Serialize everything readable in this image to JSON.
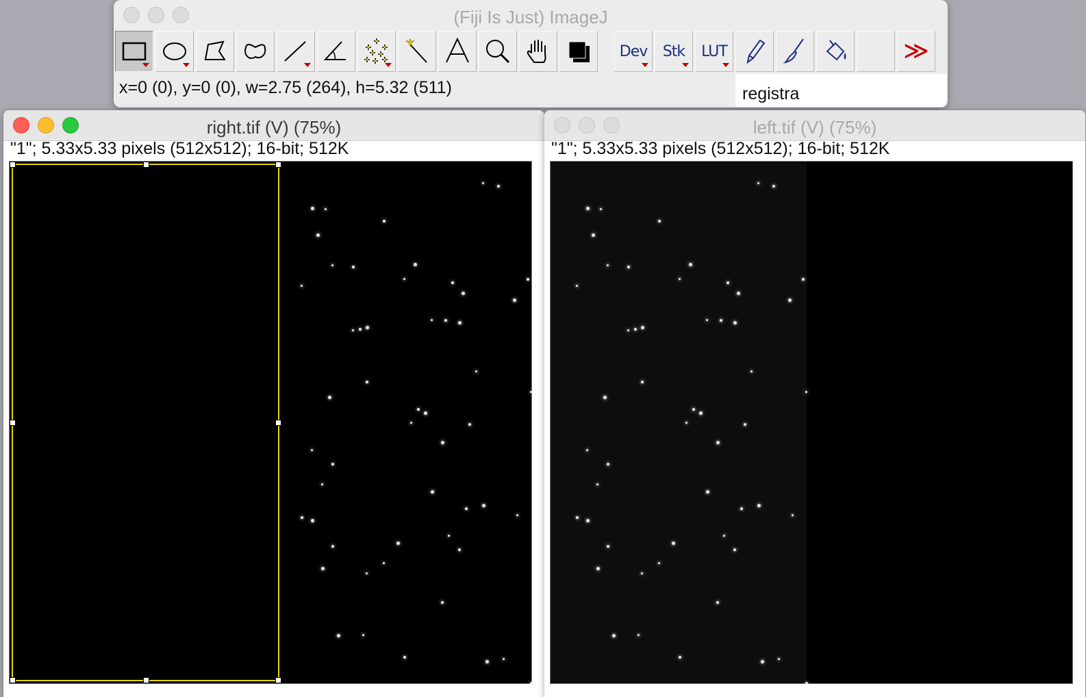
{
  "imagej": {
    "title": "(Fiji Is Just) ImageJ",
    "status": "x=0 (0), y=0 (0), w=2.75 (264), h=5.32 (511)",
    "search_value": "registra",
    "tools": [
      {
        "name": "rectangle-tool",
        "icon": "rectangle-icon",
        "selected": true
      },
      {
        "name": "oval-tool",
        "icon": "oval-icon"
      },
      {
        "name": "polygon-tool",
        "icon": "polygon-icon"
      },
      {
        "name": "freehand-tool",
        "icon": "freehand-icon"
      },
      {
        "name": "line-tool",
        "icon": "line-icon"
      },
      {
        "name": "angle-tool",
        "icon": "angle-icon"
      },
      {
        "name": "multipoint-tool",
        "icon": "multipoint-icon"
      },
      {
        "name": "wand-tool",
        "icon": "wand-icon"
      },
      {
        "name": "text-tool",
        "icon": "text-icon"
      },
      {
        "name": "magnifier-tool",
        "icon": "magnifier-icon"
      },
      {
        "name": "hand-tool",
        "icon": "hand-icon"
      },
      {
        "name": "color-picker-tool",
        "icon": "color-swatch-icon"
      }
    ],
    "menu_tools": {
      "dev": "Dev",
      "stk": "Stk",
      "lut": "LUT"
    },
    "brush_tools": [
      {
        "name": "pencil-tool",
        "icon": "pencil-icon"
      },
      {
        "name": "paintbrush-tool",
        "icon": "paintbrush-icon"
      },
      {
        "name": "flood-fill-tool",
        "icon": "flood-fill-icon"
      }
    ],
    "more_label": "≫",
    "colors": {
      "accent_red": "#c00000",
      "tool_text_blue": "#1f2f80",
      "roi_yellow": "#e8d400"
    }
  },
  "windows": {
    "right": {
      "title": "right.tif (V) (75%)",
      "info": "\"1\"; 5.33x5.33 pixels (512x512); 16-bit; 512K"
    },
    "left": {
      "title": "left.tif (V) (75%)",
      "info": "\"1\"; 5.33x5.33 pixels (512x512); 16-bit; 512K"
    }
  }
}
